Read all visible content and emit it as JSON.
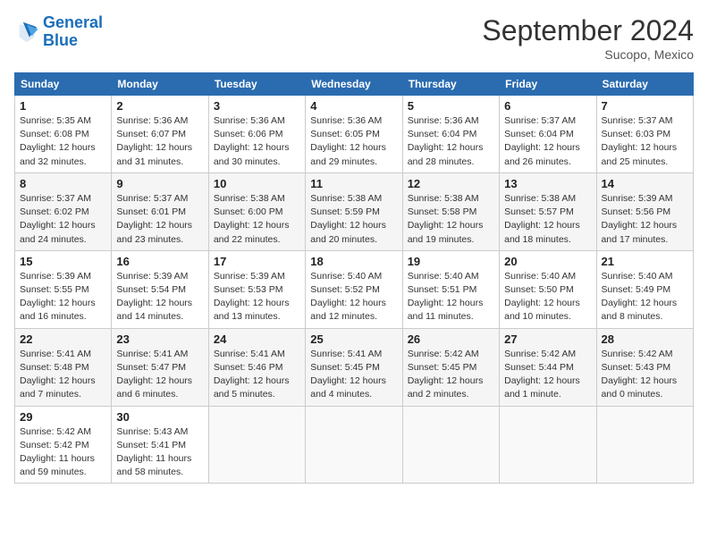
{
  "logo": {
    "line1": "General",
    "line2": "Blue"
  },
  "title": "September 2024",
  "subtitle": "Sucopo, Mexico",
  "weekdays": [
    "Sunday",
    "Monday",
    "Tuesday",
    "Wednesday",
    "Thursday",
    "Friday",
    "Saturday"
  ],
  "weeks": [
    [
      {
        "day": "1",
        "info": "Sunrise: 5:35 AM\nSunset: 6:08 PM\nDaylight: 12 hours\nand 32 minutes."
      },
      {
        "day": "2",
        "info": "Sunrise: 5:36 AM\nSunset: 6:07 PM\nDaylight: 12 hours\nand 31 minutes."
      },
      {
        "day": "3",
        "info": "Sunrise: 5:36 AM\nSunset: 6:06 PM\nDaylight: 12 hours\nand 30 minutes."
      },
      {
        "day": "4",
        "info": "Sunrise: 5:36 AM\nSunset: 6:05 PM\nDaylight: 12 hours\nand 29 minutes."
      },
      {
        "day": "5",
        "info": "Sunrise: 5:36 AM\nSunset: 6:04 PM\nDaylight: 12 hours\nand 28 minutes."
      },
      {
        "day": "6",
        "info": "Sunrise: 5:37 AM\nSunset: 6:04 PM\nDaylight: 12 hours\nand 26 minutes."
      },
      {
        "day": "7",
        "info": "Sunrise: 5:37 AM\nSunset: 6:03 PM\nDaylight: 12 hours\nand 25 minutes."
      }
    ],
    [
      {
        "day": "8",
        "info": "Sunrise: 5:37 AM\nSunset: 6:02 PM\nDaylight: 12 hours\nand 24 minutes."
      },
      {
        "day": "9",
        "info": "Sunrise: 5:37 AM\nSunset: 6:01 PM\nDaylight: 12 hours\nand 23 minutes."
      },
      {
        "day": "10",
        "info": "Sunrise: 5:38 AM\nSunset: 6:00 PM\nDaylight: 12 hours\nand 22 minutes."
      },
      {
        "day": "11",
        "info": "Sunrise: 5:38 AM\nSunset: 5:59 PM\nDaylight: 12 hours\nand 20 minutes."
      },
      {
        "day": "12",
        "info": "Sunrise: 5:38 AM\nSunset: 5:58 PM\nDaylight: 12 hours\nand 19 minutes."
      },
      {
        "day": "13",
        "info": "Sunrise: 5:38 AM\nSunset: 5:57 PM\nDaylight: 12 hours\nand 18 minutes."
      },
      {
        "day": "14",
        "info": "Sunrise: 5:39 AM\nSunset: 5:56 PM\nDaylight: 12 hours\nand 17 minutes."
      }
    ],
    [
      {
        "day": "15",
        "info": "Sunrise: 5:39 AM\nSunset: 5:55 PM\nDaylight: 12 hours\nand 16 minutes."
      },
      {
        "day": "16",
        "info": "Sunrise: 5:39 AM\nSunset: 5:54 PM\nDaylight: 12 hours\nand 14 minutes."
      },
      {
        "day": "17",
        "info": "Sunrise: 5:39 AM\nSunset: 5:53 PM\nDaylight: 12 hours\nand 13 minutes."
      },
      {
        "day": "18",
        "info": "Sunrise: 5:40 AM\nSunset: 5:52 PM\nDaylight: 12 hours\nand 12 minutes."
      },
      {
        "day": "19",
        "info": "Sunrise: 5:40 AM\nSunset: 5:51 PM\nDaylight: 12 hours\nand 11 minutes."
      },
      {
        "day": "20",
        "info": "Sunrise: 5:40 AM\nSunset: 5:50 PM\nDaylight: 12 hours\nand 10 minutes."
      },
      {
        "day": "21",
        "info": "Sunrise: 5:40 AM\nSunset: 5:49 PM\nDaylight: 12 hours\nand 8 minutes."
      }
    ],
    [
      {
        "day": "22",
        "info": "Sunrise: 5:41 AM\nSunset: 5:48 PM\nDaylight: 12 hours\nand 7 minutes."
      },
      {
        "day": "23",
        "info": "Sunrise: 5:41 AM\nSunset: 5:47 PM\nDaylight: 12 hours\nand 6 minutes."
      },
      {
        "day": "24",
        "info": "Sunrise: 5:41 AM\nSunset: 5:46 PM\nDaylight: 12 hours\nand 5 minutes."
      },
      {
        "day": "25",
        "info": "Sunrise: 5:41 AM\nSunset: 5:45 PM\nDaylight: 12 hours\nand 4 minutes."
      },
      {
        "day": "26",
        "info": "Sunrise: 5:42 AM\nSunset: 5:45 PM\nDaylight: 12 hours\nand 2 minutes."
      },
      {
        "day": "27",
        "info": "Sunrise: 5:42 AM\nSunset: 5:44 PM\nDaylight: 12 hours\nand 1 minute."
      },
      {
        "day": "28",
        "info": "Sunrise: 5:42 AM\nSunset: 5:43 PM\nDaylight: 12 hours\nand 0 minutes."
      }
    ],
    [
      {
        "day": "29",
        "info": "Sunrise: 5:42 AM\nSunset: 5:42 PM\nDaylight: 11 hours\nand 59 minutes."
      },
      {
        "day": "30",
        "info": "Sunrise: 5:43 AM\nSunset: 5:41 PM\nDaylight: 11 hours\nand 58 minutes."
      },
      null,
      null,
      null,
      null,
      null
    ]
  ]
}
